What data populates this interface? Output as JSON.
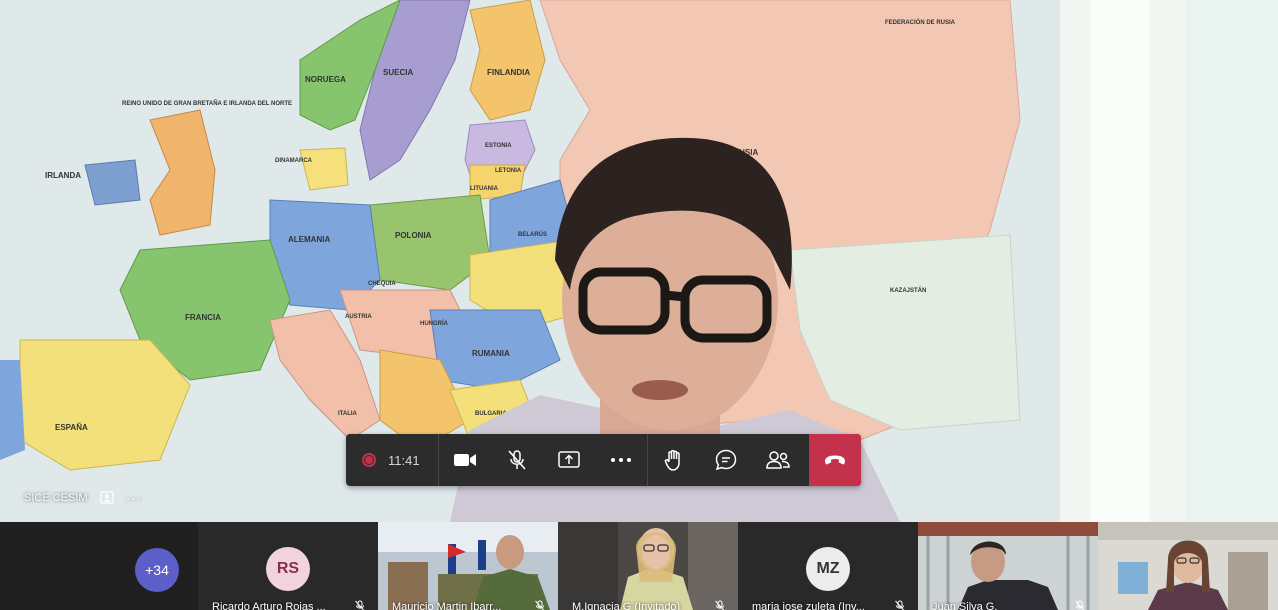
{
  "stage": {
    "speaker_name": "SICE CESIM",
    "map_labels": {
      "uk": "REINO UNIDO DE GRAN BRETAÑA E IRLANDA DEL NORTE",
      "irlanda": "IRLANDA",
      "noruega": "NORUEGA",
      "suecia": "SUECIA",
      "finlandia": "FINLANDIA",
      "federacion": "FEDERACIÓN DE RUSIA",
      "de_rusia": "DE RUSIA",
      "estonia": "ESTONIA",
      "letonia": "LETONIA",
      "lituania": "LITUANIA",
      "dinamarca": "DINAMARCA",
      "alemania": "ALEMANIA",
      "polonia": "POLONIA",
      "belarus": "BELARÚS",
      "francia": "FRANCIA",
      "austria": "AUSTRIA",
      "chequia": "CHEQUIA",
      "hungria": "HUNGRÍA",
      "rumania": "RUMANIA",
      "bulgaria": "BULGARIA",
      "italia": "ITALIA",
      "espana": "ESPAÑA",
      "kazajstan": "KAZAJSTÁN"
    }
  },
  "controls": {
    "timer": "11:41",
    "icons": {
      "record": "record-icon",
      "camera": "camera-icon",
      "mic": "mic-muted-icon",
      "share": "share-screen-icon",
      "more": "more-options-icon",
      "hand": "raise-hand-icon",
      "chat": "chat-icon",
      "people": "participants-icon",
      "hangup": "hang-up-icon"
    },
    "colors": {
      "bar": "#2d2c2c",
      "hangup": "#c4314b",
      "record": "#c4314b"
    }
  },
  "gallery": {
    "overflow_count": "+34",
    "participants": [
      {
        "name": "Ricardo Arturo Rojas ...",
        "initials": "RS",
        "avatar_bg": "#f0d3dc",
        "avatar_fg": "#8a2d4b",
        "video": false
      },
      {
        "name": "Mauricio Martin Ibarr...",
        "initials": "",
        "video": true
      },
      {
        "name": "M.Ignacia G (Invitado)",
        "initials": "",
        "video": true
      },
      {
        "name": "maria jose zuleta (Inv...",
        "initials": "MZ",
        "avatar_bg": "#ececec",
        "avatar_fg": "#333333",
        "video": false
      },
      {
        "name": "Juan Silva G.",
        "initials": "",
        "video": true
      },
      {
        "name": "",
        "initials": "",
        "video": true
      }
    ]
  }
}
